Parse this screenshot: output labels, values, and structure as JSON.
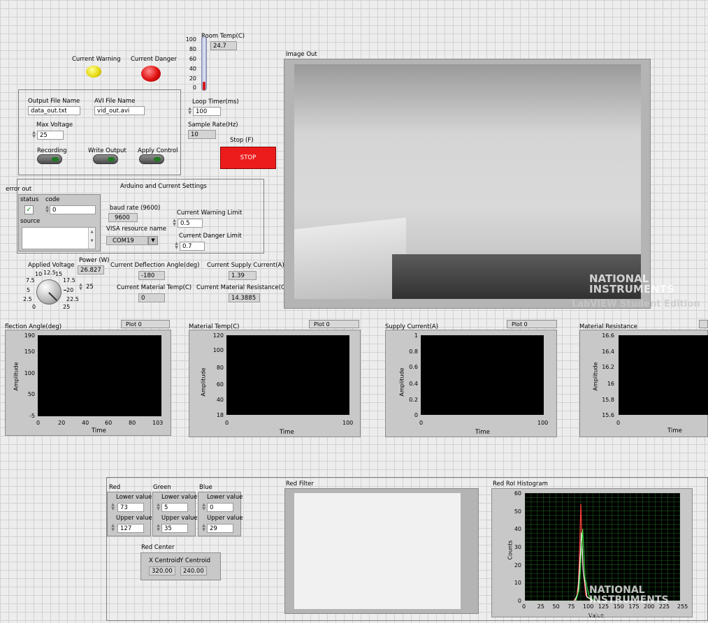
{
  "room_temp": {
    "label": "Room Temp(C)",
    "value": "24.7",
    "scale": [
      "100",
      "80",
      "60",
      "40",
      "20",
      "0"
    ]
  },
  "current_warning": {
    "label": "Current Warning"
  },
  "current_danger": {
    "label": "Current Danger"
  },
  "output_file": {
    "label": "Output File Name",
    "value": "data_out.txt"
  },
  "avi_file": {
    "label": "AVI File Name",
    "value": "vid_out.avi"
  },
  "max_voltage": {
    "label": "Max Voltage",
    "value": "25"
  },
  "recording": {
    "label": "Recording"
  },
  "write_output": {
    "label": "Write Output"
  },
  "apply_control": {
    "label": "Apply Control"
  },
  "loop_timer": {
    "label": "Loop Timer(ms)",
    "value": "100"
  },
  "sample_rate": {
    "label": "Sample Rate(Hz)",
    "value": "10"
  },
  "stop": {
    "label": "Stop (F)",
    "button": "STOP"
  },
  "arduino": {
    "title": "Arduino and Current Settings",
    "baud_label": "baud rate (9600)",
    "baud_value": "9600",
    "visa_label": "VISA resource name",
    "visa_value": "COM19",
    "warn_limit_label": "Current Warning Limit",
    "warn_limit_value": "0.5",
    "danger_limit_label": "Current Danger Limit",
    "danger_limit_value": "0.7"
  },
  "error_out": {
    "label": "error out",
    "status_label": "status",
    "code_label": "code",
    "code_value": "0",
    "source_label": "source"
  },
  "applied_voltage": {
    "label": "Applied Voltage",
    "value": "25",
    "dial_ticks": [
      "0",
      "2.5",
      "5",
      "7.5",
      "10",
      "12.5",
      "15",
      "17.5",
      "20",
      "22.5",
      "25"
    ]
  },
  "power": {
    "label": "Power (W)",
    "value": "26.827"
  },
  "deflection_angle": {
    "label": "Current Deflection Angle(deg)",
    "value": "-180"
  },
  "supply_current": {
    "label": "Current Supply Current(A)",
    "value": "1.39"
  },
  "material_temp": {
    "label": "Current Material Temp(C)",
    "value": "0"
  },
  "material_resistance": {
    "label": "Current Material Resistance(Ohm)",
    "value": "14.3885"
  },
  "image_out": {
    "label": "Image Out"
  },
  "watermark": {
    "line1": "NATIONAL",
    "line2": "INSTRUMENTS",
    "line3": "LabVIEW  Student Edition"
  },
  "charts": {
    "deflection": {
      "title": "flection Angle(deg)",
      "legend": "Plot 0",
      "ylabel": "Amplitude",
      "xlabel": "Time",
      "y_ticks": [
        "190",
        "150",
        "100",
        "50",
        "-5"
      ],
      "x_ticks": [
        "0",
        "20",
        "40",
        "60",
        "80",
        "103"
      ]
    },
    "mattemp": {
      "title": "Material Temp(C)",
      "legend": "Plot 0",
      "ylabel": "Amplitude",
      "xlabel": "Time",
      "y_ticks": [
        "120",
        "100",
        "80",
        "60",
        "40",
        "18"
      ],
      "x_ticks": [
        "0",
        "100"
      ]
    },
    "supply": {
      "title": "Supply Current(A)",
      "legend": "Plot 0",
      "ylabel": "Amplitude",
      "xlabel": "Time",
      "y_ticks": [
        "1",
        "0.8",
        "0.6",
        "0.4",
        "0.2",
        "0"
      ],
      "x_ticks": [
        "0",
        "100"
      ]
    },
    "resistance": {
      "title": "Material Resistance",
      "ylabel": "Amplitude",
      "xlabel": "Time",
      "y_ticks": [
        "16.6",
        "16.4",
        "16.2",
        "16",
        "15.8",
        "15.6"
      ],
      "x_ticks": [
        "0"
      ]
    }
  },
  "rgb": {
    "red_label": "Red",
    "green_label": "Green",
    "blue_label": "Blue",
    "lower_label": "Lower value",
    "upper_label": "Upper value",
    "red_lower": "73",
    "red_upper": "127",
    "green_lower": "5",
    "green_upper": "35",
    "blue_lower": "0",
    "blue_upper": "29"
  },
  "red_center": {
    "label": "Red Center",
    "x_label": "X Centroid",
    "y_label": "Y Centroid",
    "x_value": "320.00",
    "y_value": "240.00"
  },
  "red_filter": {
    "label": "Red Filter"
  },
  "histogram": {
    "title": "Red RoI Histogram",
    "ylabel": "Counts",
    "xlabel": "Value",
    "y_ticks": [
      "60",
      "50",
      "40",
      "30",
      "20",
      "10",
      "0"
    ],
    "x_ticks": [
      "0",
      "25",
      "50",
      "75",
      "100",
      "125",
      "150",
      "175",
      "200",
      "225",
      "255"
    ]
  },
  "chart_data": {
    "type": "line",
    "title": "Red RoI Histogram",
    "xlabel": "Value",
    "ylabel": "Counts",
    "xlim": [
      0,
      255
    ],
    "ylim": [
      0,
      60
    ],
    "series": [
      {
        "color": "#ff3b3b",
        "x": [
          80,
          85,
          88,
          90,
          92,
          95,
          100,
          110
        ],
        "y": [
          0,
          2,
          10,
          30,
          54,
          20,
          3,
          0
        ]
      },
      {
        "color": "#ffffff",
        "x": [
          82,
          87,
          90,
          93,
          96,
          102,
          112
        ],
        "y": [
          0,
          4,
          18,
          38,
          16,
          2,
          0
        ]
      },
      {
        "color": "#37d337",
        "x": [
          84,
          89,
          92,
          95,
          99,
          106,
          115
        ],
        "y": [
          0,
          6,
          22,
          40,
          12,
          2,
          0
        ]
      }
    ]
  }
}
